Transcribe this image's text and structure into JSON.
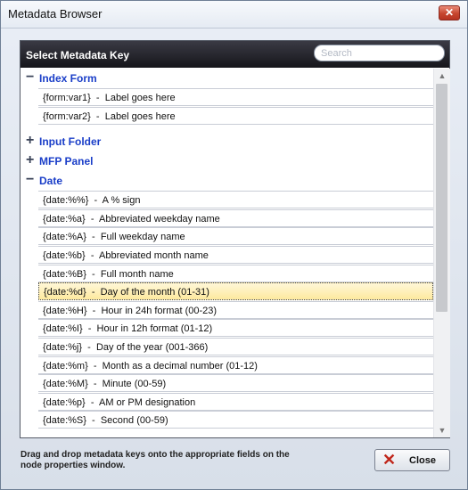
{
  "window": {
    "title": "Metadata Browser",
    "close_icon": "✕"
  },
  "panel": {
    "title": "Select Metadata Key",
    "search_placeholder": "Search",
    "search_value": ""
  },
  "groups": [
    {
      "name": "Index Form",
      "expanded": true,
      "items": [
        {
          "key": "{form:var1}",
          "desc": "Label goes here"
        },
        {
          "key": "{form:var2}",
          "desc": "Label goes here"
        }
      ]
    },
    {
      "name": "Input Folder",
      "expanded": false,
      "items": []
    },
    {
      "name": "MFP Panel",
      "expanded": false,
      "items": []
    },
    {
      "name": "Date",
      "expanded": true,
      "items": [
        {
          "key": "{date:%%}",
          "desc": "A % sign"
        },
        {
          "key": "{date:%a}",
          "desc": "Abbreviated weekday name"
        },
        {
          "key": "{date:%A}",
          "desc": "Full weekday name"
        },
        {
          "key": "{date:%b}",
          "desc": "Abbreviated month name"
        },
        {
          "key": "{date:%B}",
          "desc": "Full month name"
        },
        {
          "key": "{date:%d}",
          "desc": "Day of the month (01-31)",
          "selected": true
        },
        {
          "key": "{date:%H}",
          "desc": "Hour in 24h format (00-23)"
        },
        {
          "key": "{date:%I}",
          "desc": "Hour in 12h format (01-12)"
        },
        {
          "key": "{date:%j}",
          "desc": "Day of the year (001-366)"
        },
        {
          "key": "{date:%m}",
          "desc": "Month as a decimal number (01-12)"
        },
        {
          "key": "{date:%M}",
          "desc": "Minute (00-59)"
        },
        {
          "key": "{date:%p}",
          "desc": "AM or PM designation"
        },
        {
          "key": "{date:%S}",
          "desc": "Second (00-59)"
        }
      ]
    }
  ],
  "symbols": {
    "expanded": "−",
    "collapsed": "+"
  },
  "separator": "  -  ",
  "footer": {
    "hint": "Drag and drop metadata keys onto the appropriate fields on the node properties window.",
    "close_label": "Close",
    "close_icon": "✕"
  },
  "scrollbar": {
    "up_icon": "▲",
    "down_icon": "▼"
  },
  "colors": {
    "group_text": "#1a3ec8",
    "selected_row": "#fde99e",
    "header_bg": "#16161b"
  }
}
